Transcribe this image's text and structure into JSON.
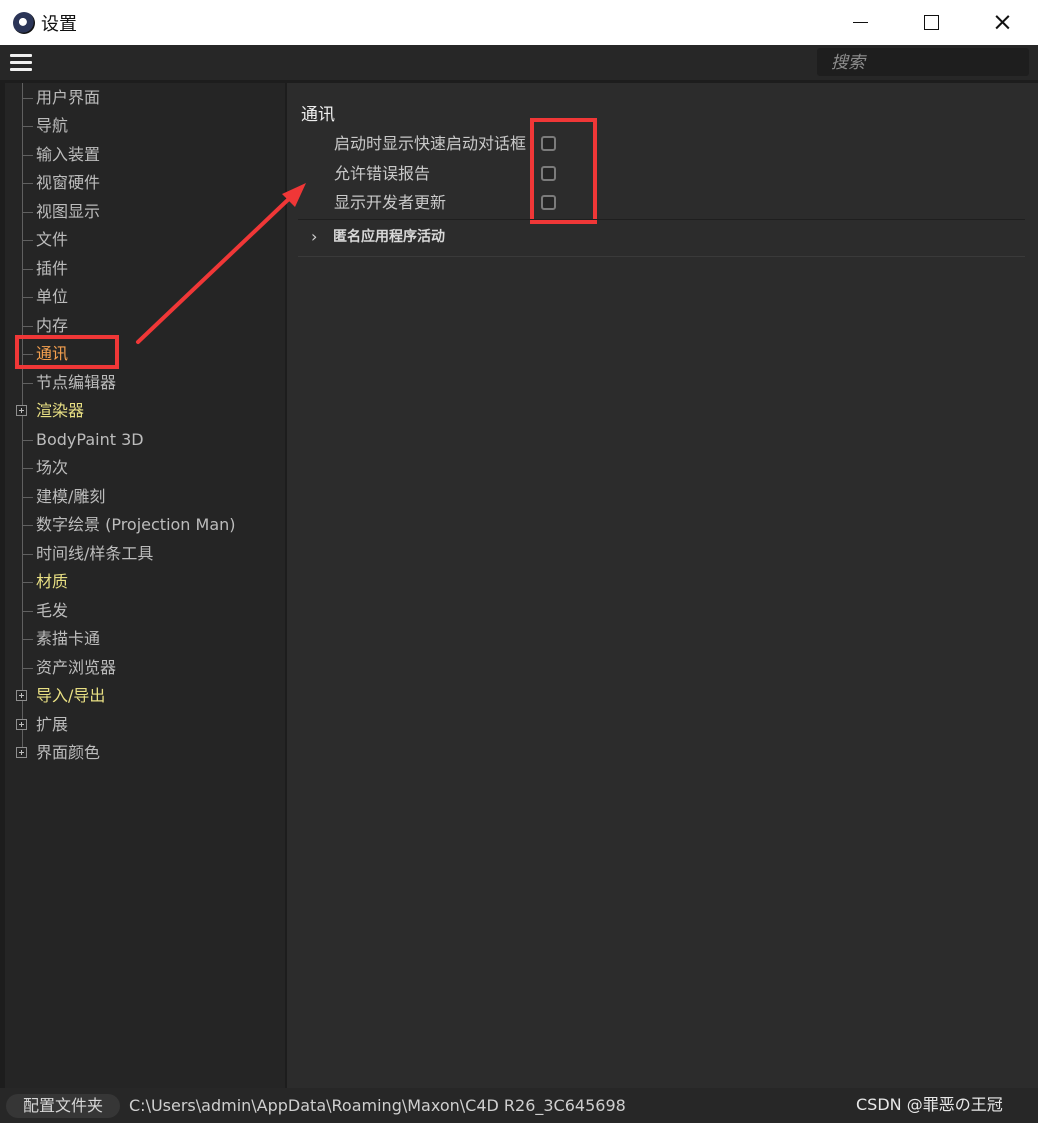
{
  "window": {
    "title": "设置",
    "controls": {
      "minimize": "—",
      "maximize": "□",
      "close": "×"
    }
  },
  "toolbar": {
    "menu_icon": "hamburger-menu-icon",
    "search": {
      "placeholder": "搜索",
      "value": ""
    }
  },
  "sidebar": {
    "items": [
      {
        "label": "用户界面",
        "state": "normal"
      },
      {
        "label": "导航",
        "state": "normal"
      },
      {
        "label": "输入装置",
        "state": "normal"
      },
      {
        "label": "视窗硬件",
        "state": "normal"
      },
      {
        "label": "视图显示",
        "state": "normal"
      },
      {
        "label": "文件",
        "state": "normal"
      },
      {
        "label": "插件",
        "state": "normal"
      },
      {
        "label": "单位",
        "state": "normal"
      },
      {
        "label": "内存",
        "state": "normal"
      },
      {
        "label": "通讯",
        "state": "selected"
      },
      {
        "label": "节点编辑器",
        "state": "normal"
      },
      {
        "label": "渲染器",
        "state": "expandable"
      },
      {
        "label": "BodyPaint 3D",
        "state": "normal"
      },
      {
        "label": "场次",
        "state": "normal"
      },
      {
        "label": "建模/雕刻",
        "state": "normal"
      },
      {
        "label": "数字绘景 (Projection Man)",
        "state": "normal"
      },
      {
        "label": "时间线/样条工具",
        "state": "normal"
      },
      {
        "label": "材质",
        "state": "group"
      },
      {
        "label": "毛发",
        "state": "normal"
      },
      {
        "label": "素描卡通",
        "state": "normal"
      },
      {
        "label": "资产浏览器",
        "state": "normal"
      },
      {
        "label": "导入/导出",
        "state": "expandable"
      },
      {
        "label": "扩展",
        "state": "expandable"
      },
      {
        "label": "界面颜色",
        "state": "expandable"
      }
    ]
  },
  "main": {
    "section_title": "通讯",
    "options": [
      {
        "label": "启动时显示快速启动对话框",
        "checked": false
      },
      {
        "label": "允许错误报告",
        "checked": false
      },
      {
        "label": "显示开发者更新",
        "checked": false
      }
    ],
    "collapsible": {
      "label": "匿名应用程序活动",
      "expanded": false
    }
  },
  "annotations": {
    "highlight_color": "#f03737"
  },
  "statusbar": {
    "profile_button": "配置文件夹",
    "path": "C:\\Users\\admin\\AppData\\Roaming\\Maxon\\C4D R26_3C645698",
    "watermark": "CSDN @罪恶の王冠"
  },
  "colors": {
    "background": "#1d1d1d",
    "sidebar": "#252525",
    "main_panel": "#2c2c2c",
    "selected_text": "#f5a04f",
    "group_text": "#e8df83",
    "normal_text": "#bcbcbc"
  }
}
